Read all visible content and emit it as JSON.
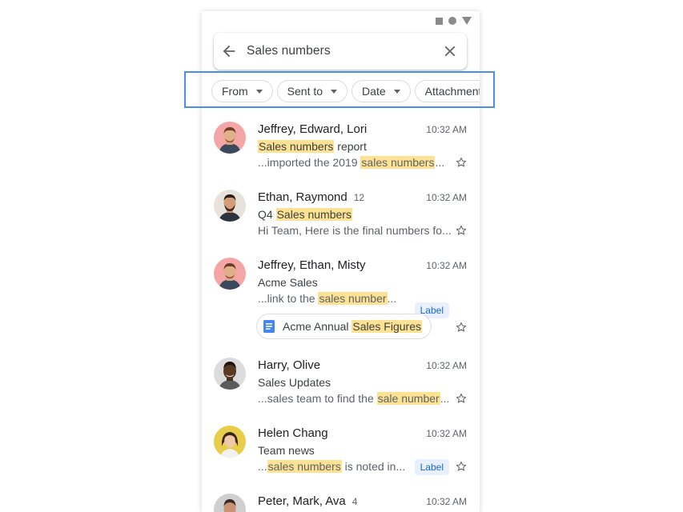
{
  "search": {
    "query": "Sales numbers"
  },
  "filters": [
    {
      "label": "From"
    },
    {
      "label": "Sent to"
    },
    {
      "label": "Date"
    },
    {
      "label": "Attachment"
    }
  ],
  "emails": [
    {
      "sender": "Jeffrey, Edward, Lori",
      "count": "",
      "time": "10:32 AM",
      "subject_pre": "",
      "subject_hl": "Sales numbers",
      "subject_post": " report",
      "snippet_pre": "...imported the 2019 ",
      "snippet_hl": "sales numbers",
      "snippet_post": "...",
      "label": "",
      "avatar": "avatar-jeffrey"
    },
    {
      "sender": "Ethan, Raymond",
      "count": "12",
      "time": "10:32 AM",
      "subject_pre": "Q4 ",
      "subject_hl": "Sales numbers",
      "subject_post": "",
      "snippet_pre": "Hi Team, Here is the final numbers fo...",
      "snippet_hl": "",
      "snippet_post": "",
      "label": "",
      "avatar": "avatar-ethan"
    },
    {
      "sender": "Jeffrey, Ethan, Misty",
      "count": "",
      "time": "10:32 AM",
      "subject_pre": "Acme Sales",
      "subject_hl": "",
      "subject_post": "",
      "snippet_pre": "...link to the ",
      "snippet_hl": "sales number",
      "snippet_post": "...",
      "label": "Label",
      "attachment_pre": "Acme Annual ",
      "attachment_hl": "Sales Figures",
      "avatar": "avatar-jeffrey"
    },
    {
      "sender": "Harry, Olive",
      "count": "",
      "time": "10:32 AM",
      "subject_pre": "Sales Updates",
      "subject_hl": "",
      "subject_post": "",
      "snippet_pre": "...sales team to find the ",
      "snippet_hl": "sale number",
      "snippet_post": "...",
      "label": "",
      "avatar": "avatar-harry"
    },
    {
      "sender": "Helen Chang",
      "count": "",
      "time": "10:32 AM",
      "subject_pre": "Team news",
      "subject_hl": "",
      "subject_post": "",
      "snippet_pre": "...",
      "snippet_hl": "sales numbers",
      "snippet_post": " is noted in...",
      "label": "Label",
      "avatar": "avatar-helen"
    },
    {
      "sender": "Peter, Mark, Ava",
      "count": "4",
      "time": "10:32 AM",
      "avatar": "avatar-peter"
    }
  ],
  "colors": {
    "highlight": "#fde293",
    "label_bg": "#e8f0fe",
    "label_text": "#1967d2",
    "focus_box": "#4a90e2",
    "doc_icon": "#4285f4"
  }
}
